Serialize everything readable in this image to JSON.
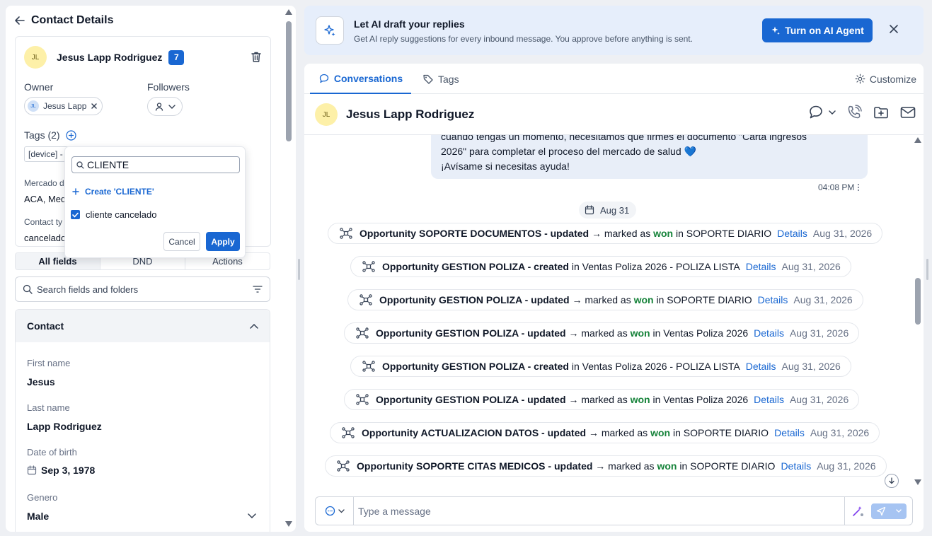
{
  "contact_details": {
    "title": "Contact Details",
    "initials": "JL",
    "name": "Jesus Lapp Rodriguez",
    "badge": "7",
    "owner_label": "Owner",
    "owner_initials": "JL",
    "owner_name": "Jesus Lapp",
    "followers_label": "Followers",
    "tags_label": "Tags (2)",
    "tag_chips": [
      "[device] - ",
      ""
    ],
    "field1_label": "Mercado d",
    "field1_value": "ACA, Med",
    "field2_label": "Contact ty",
    "field2_value": "cancelado"
  },
  "tag_dropdown": {
    "search_value": "CLIENTE",
    "create_label": "Create 'CLIENTE'",
    "option_label": "cliente cancelado",
    "cancel_label": "Cancel",
    "apply_label": "Apply"
  },
  "field_tabs": [
    "All fields",
    "DND",
    "Actions"
  ],
  "search_fields": {
    "placeholder": "Search fields and folders"
  },
  "contact_section": {
    "title": "Contact",
    "first_name_label": "First name",
    "first_name_value": "Jesus",
    "last_name_label": "Last name",
    "last_name_value": "Lapp Rodriguez",
    "dob_label": "Date of birth",
    "dob_value": "Sep 3, 1978",
    "genero_label": "Genero",
    "genero_value": "Male"
  },
  "banner": {
    "title": "Let AI draft your replies",
    "subtitle": "Get AI reply suggestions for every inbound message. You approve before anything is sent.",
    "button_label": "Turn on AI Agent"
  },
  "conversation": {
    "tab_conversations": "Conversations",
    "tab_tags": "Tags",
    "customize": "Customize",
    "contact_initials": "JL",
    "contact_name": "Jesus Lapp Rodriguez",
    "bubble_lines": [
      "cuando tengas un momento, necesitamos que firmes el documento \"Carta ingresos",
      "2026\" para completar el proceso del mercado de salud 💙",
      "¡Avísame si necesitas ayuda!"
    ],
    "message_time": "04:08 PM",
    "date_divider": "Aug 31",
    "activities": [
      {
        "name": "Opportunity SOPORTE DOCUMENTOS - updated",
        "arrow": " → marked as ",
        "status": "won",
        "mid": " in SOPORTE DIARIO",
        "details": "Details",
        "date": "Aug 31, 2026"
      },
      {
        "name": "Opportunity GESTION POLIZA - created",
        "arrow": "",
        "status": "",
        "mid": " in Ventas Poliza 2026 - POLIZA LISTA",
        "details": "Details",
        "date": "Aug 31, 2026"
      },
      {
        "name": "Opportunity GESTION POLIZA - updated",
        "arrow": " → marked as ",
        "status": "won",
        "mid": " in SOPORTE DIARIO",
        "details": "Details",
        "date": "Aug 31, 2026"
      },
      {
        "name": "Opportunity GESTION POLIZA - updated",
        "arrow": " → marked as ",
        "status": "won",
        "mid": " in Ventas Poliza 2026",
        "details": "Details",
        "date": "Aug 31, 2026"
      },
      {
        "name": "Opportunity GESTION POLIZA - created",
        "arrow": "",
        "status": "",
        "mid": " in Ventas Poliza 2026 - POLIZA LISTA",
        "details": "Details",
        "date": "Aug 31, 2026"
      },
      {
        "name": "Opportunity GESTION POLIZA - updated",
        "arrow": " → marked as ",
        "status": "won",
        "mid": " in Ventas Poliza 2026",
        "details": "Details",
        "date": "Aug 31, 2026"
      },
      {
        "name": "Opportunity ACTUALIZACION DATOS - updated",
        "arrow": " → marked as ",
        "status": "won",
        "mid": " in SOPORTE DIARIO",
        "details": "Details",
        "date": "Aug 31, 2026"
      },
      {
        "name": "Opportunity SOPORTE CITAS MEDICOS - updated",
        "arrow": " → marked as ",
        "status": "won",
        "mid": " in SOPORTE DIARIO",
        "details": "Details",
        "date": "Aug 31, 2026"
      }
    ],
    "composer_placeholder": "Type a message"
  },
  "colors": {
    "accent": "#1967d2",
    "won": "#16833a",
    "banner_bg": "#e6eefb",
    "bubble_bg": "#e8eef8"
  }
}
